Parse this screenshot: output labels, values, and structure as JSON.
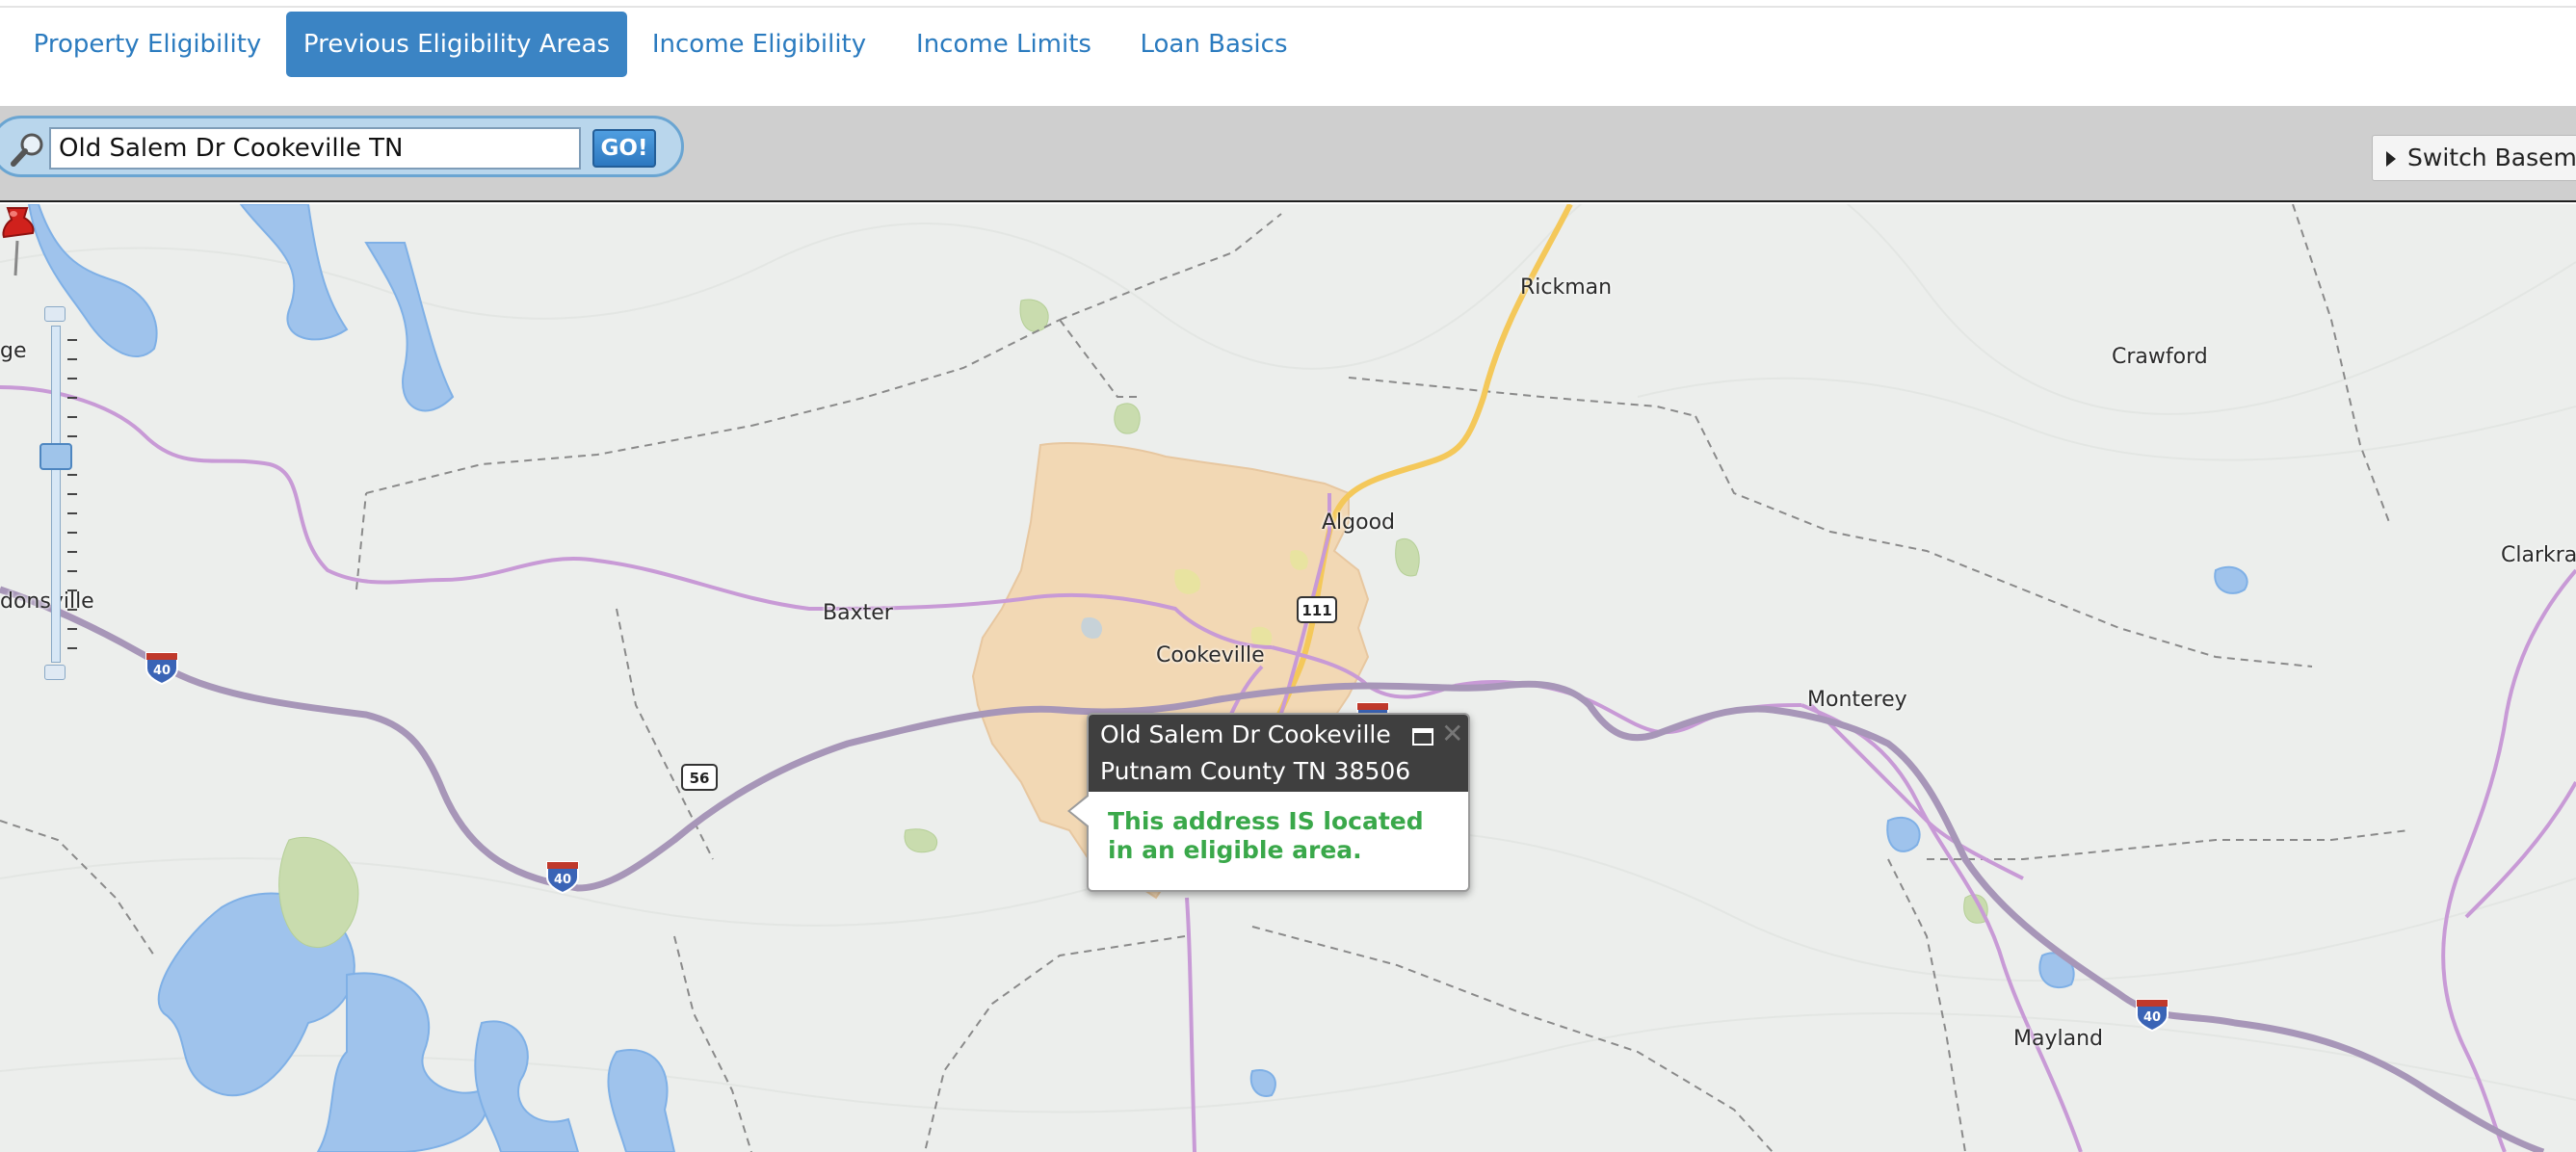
{
  "tabs": [
    {
      "label": "Property Eligibility",
      "active": false
    },
    {
      "label": "Previous Eligibility Areas",
      "active": true
    },
    {
      "label": "Income Eligibility",
      "active": false
    },
    {
      "label": "Income Limits",
      "active": false
    },
    {
      "label": "Loan Basics",
      "active": false
    }
  ],
  "search": {
    "value": "Old Salem Dr Cookeville TN",
    "go_label": "GO!"
  },
  "basemap": {
    "label": "Switch Basema"
  },
  "map": {
    "places": {
      "rickman": "Rickman",
      "crawford": "Crawford",
      "algood": "Algood",
      "clarkra": "Clarkra",
      "baxter": "Baxter",
      "cookeville": "Cookeville",
      "monterey": "Monterey",
      "mayland": "Mayland",
      "ge": "ge",
      "donsville": "donsville"
    },
    "shields": {
      "i40_a": "40",
      "i40_b": "40",
      "i40_c": "40",
      "i40_d": "40",
      "sr56": "56",
      "sr111": "111"
    }
  },
  "popup": {
    "line1": "Old Salem Dr Cookeville",
    "line2": "Putnam County TN 38506",
    "message": "This address IS located in an eligible area.",
    "close_glyph": "✕"
  },
  "colors": {
    "accent": "#3b84c4",
    "eligible_text": "#3aa84a",
    "ineligible_area": "#f3d7b2"
  }
}
